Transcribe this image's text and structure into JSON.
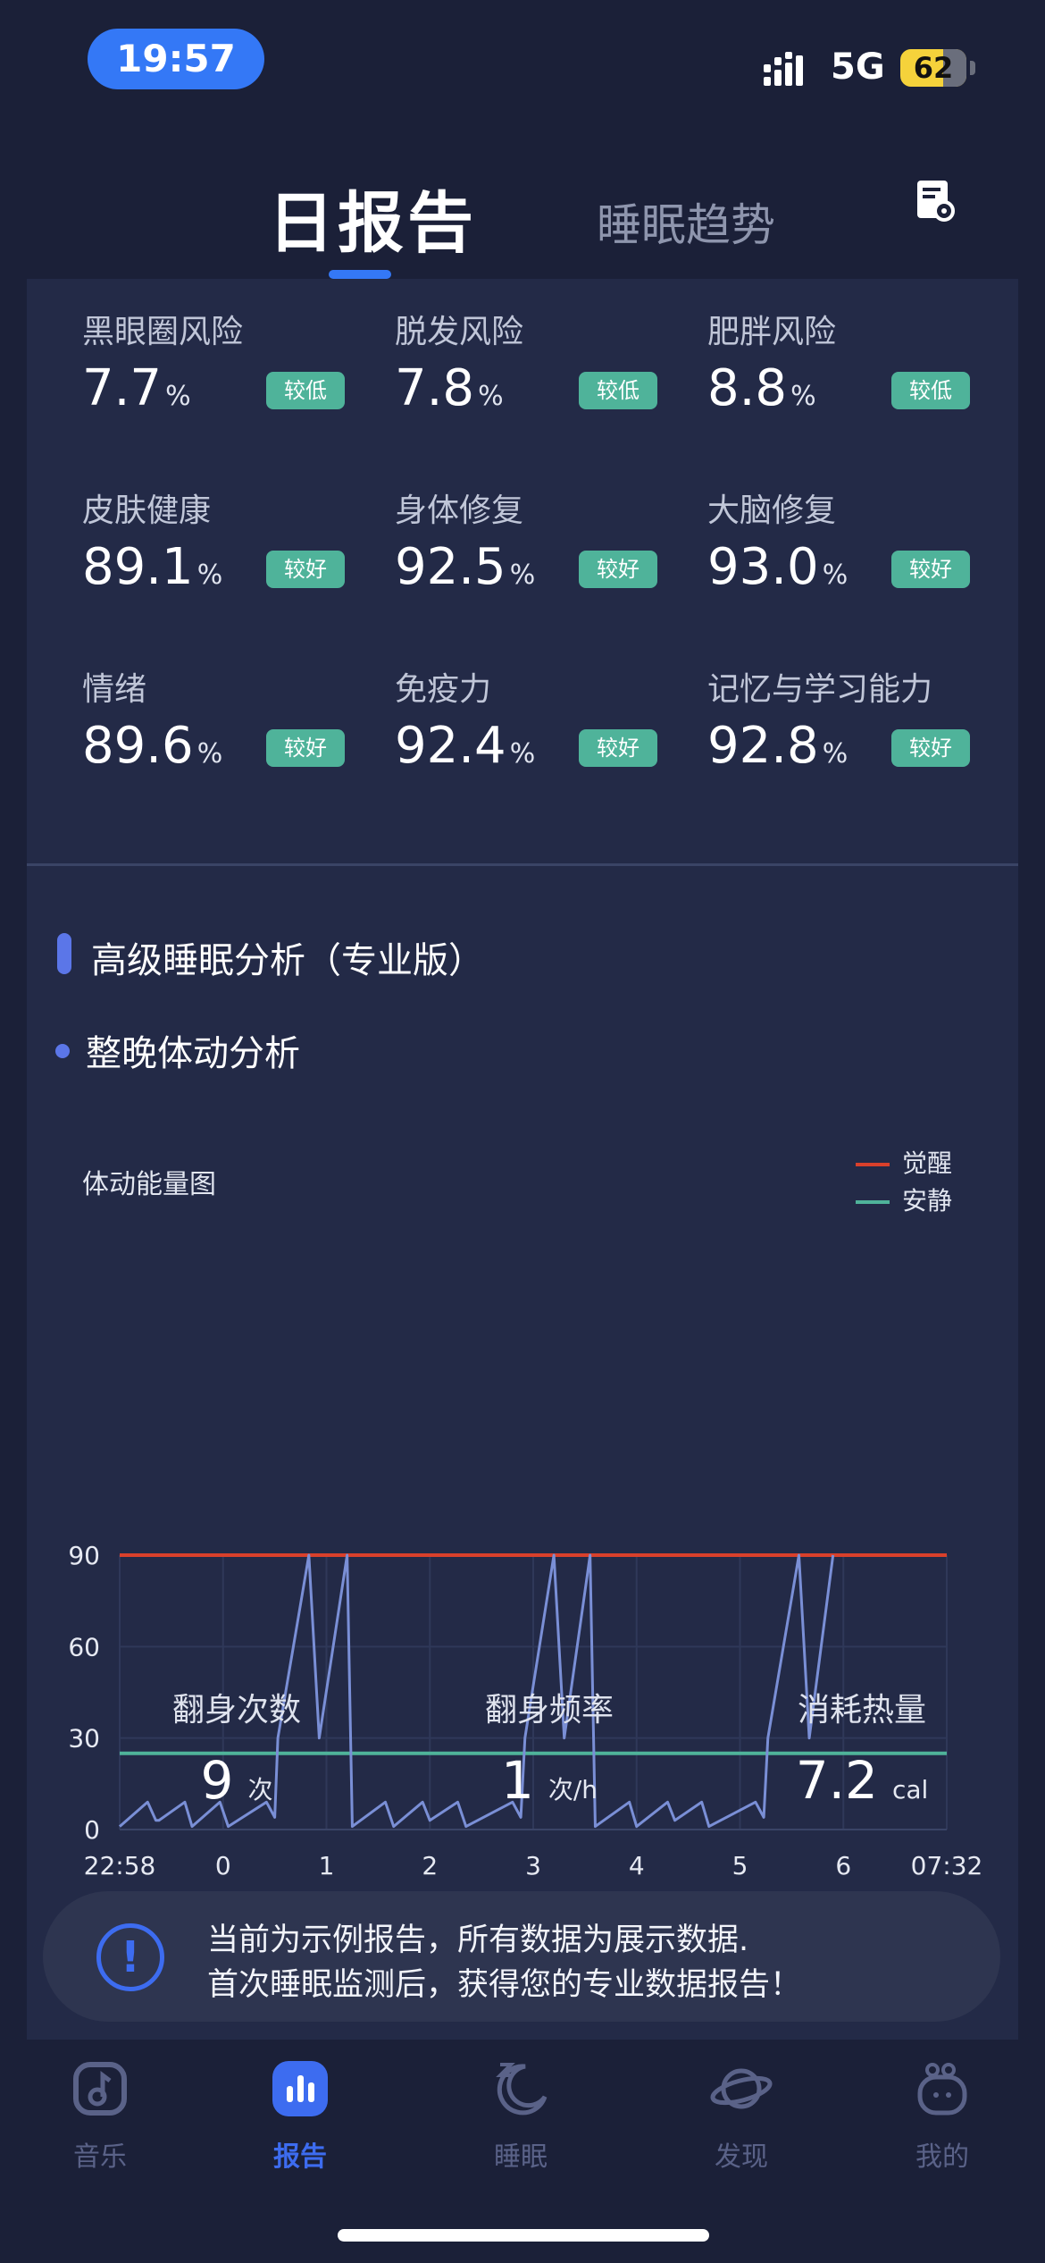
{
  "status_bar": {
    "time": "19:57",
    "network": "5G",
    "battery": "62"
  },
  "header": {
    "tab_day": "日报告",
    "tab_trend": "睡眠趋势",
    "report_icon": "report-icon"
  },
  "metrics": [
    {
      "label": "黑眼圈风险",
      "value": "7.7",
      "unit": "%",
      "badge": "较低"
    },
    {
      "label": "脱发风险",
      "value": "7.8",
      "unit": "%",
      "badge": "较低"
    },
    {
      "label": "肥胖风险",
      "value": "8.8",
      "unit": "%",
      "badge": "较低"
    },
    {
      "label": "皮肤健康",
      "value": "89.1",
      "unit": "%",
      "badge": "较好"
    },
    {
      "label": "身体修复",
      "value": "92.5",
      "unit": "%",
      "badge": "较好"
    },
    {
      "label": "大脑修复",
      "value": "93.0",
      "unit": "%",
      "badge": "较好"
    },
    {
      "label": "情绪",
      "value": "89.6",
      "unit": "%",
      "badge": "较好"
    },
    {
      "label": "免疫力",
      "value": "92.4",
      "unit": "%",
      "badge": "较好"
    },
    {
      "label": "记忆与学习能力",
      "value": "92.8",
      "unit": "%",
      "badge": "较好"
    }
  ],
  "advanced": {
    "title": "高级睡眠分析（专业版）",
    "subtitle": "整晚体动分析"
  },
  "chart_data": {
    "type": "line",
    "title": "体动能量图",
    "x_tick_labels": [
      "22:58",
      "0",
      "1",
      "2",
      "3",
      "4",
      "5",
      "6",
      "07:32"
    ],
    "y_ticks": [
      0,
      30,
      60,
      90
    ],
    "ylim": [
      0,
      90
    ],
    "grid": true,
    "legend": {
      "position": "top-right",
      "items": [
        {
          "name": "觉醒",
          "color": "#d9402b"
        },
        {
          "name": "安静",
          "color": "#4fb39a"
        }
      ]
    },
    "series": [
      {
        "name": "觉醒",
        "color": "#d9402b",
        "values": [
          90,
          90
        ]
      },
      {
        "name": "安静",
        "color": "#4fb39a",
        "values": [
          25,
          25
        ]
      },
      {
        "color": "#7a8fd6",
        "values": [
          [
            0,
            1
          ],
          [
            0.27,
            9
          ],
          [
            0.35,
            3
          ],
          [
            0.38,
            3
          ],
          [
            0.63,
            9
          ],
          [
            0.7,
            1
          ],
          [
            0.97,
            9
          ],
          [
            1.05,
            1
          ],
          [
            1.42,
            9
          ],
          [
            1.5,
            4
          ],
          [
            1.53,
            30
          ],
          [
            1.83,
            90
          ],
          [
            1.93,
            30
          ],
          [
            2.2,
            90
          ],
          [
            2.25,
            1
          ],
          [
            2.57,
            9
          ],
          [
            2.65,
            1
          ],
          [
            2.93,
            9
          ],
          [
            3.0,
            3
          ],
          [
            3.27,
            9
          ],
          [
            3.35,
            1
          ],
          [
            3.8,
            9
          ],
          [
            3.88,
            4
          ],
          [
            3.92,
            30
          ],
          [
            4.2,
            90
          ],
          [
            4.3,
            30
          ],
          [
            4.55,
            90
          ],
          [
            4.6,
            1
          ],
          [
            4.93,
            9
          ],
          [
            5.0,
            1
          ],
          [
            5.3,
            9
          ],
          [
            5.37,
            3
          ],
          [
            5.63,
            9
          ],
          [
            5.7,
            1
          ],
          [
            6.15,
            9
          ],
          [
            6.23,
            4
          ],
          [
            6.27,
            30
          ],
          [
            6.57,
            90
          ],
          [
            6.67,
            30
          ],
          [
            6.9,
            90
          ]
        ]
      }
    ]
  },
  "stats": [
    {
      "label": "翻身次数",
      "value": "9",
      "unit": "次"
    },
    {
      "label": "翻身频率",
      "value": "1",
      "unit": "次/h"
    },
    {
      "label": "消耗热量",
      "value": "7.2",
      "unit": "cal"
    }
  ],
  "notice": {
    "line1": "当前为示例报告，所有数据为展示数据.",
    "line2": "首次睡眠监测后，获得您的专业数据报告！"
  },
  "nav": [
    {
      "label": "音乐",
      "icon": "music-icon",
      "active": false
    },
    {
      "label": "报告",
      "icon": "report-chart-icon",
      "active": true
    },
    {
      "label": "睡眠",
      "icon": "moon-icon",
      "active": false
    },
    {
      "label": "发现",
      "icon": "planet-icon",
      "active": false
    },
    {
      "label": "我的",
      "icon": "profile-icon",
      "active": false
    }
  ],
  "colors": {
    "accent": "#3478f6",
    "badge": "#4fb39a",
    "awake": "#d9402b",
    "quiet": "#4fb39a",
    "movement": "#7a8fd6"
  }
}
